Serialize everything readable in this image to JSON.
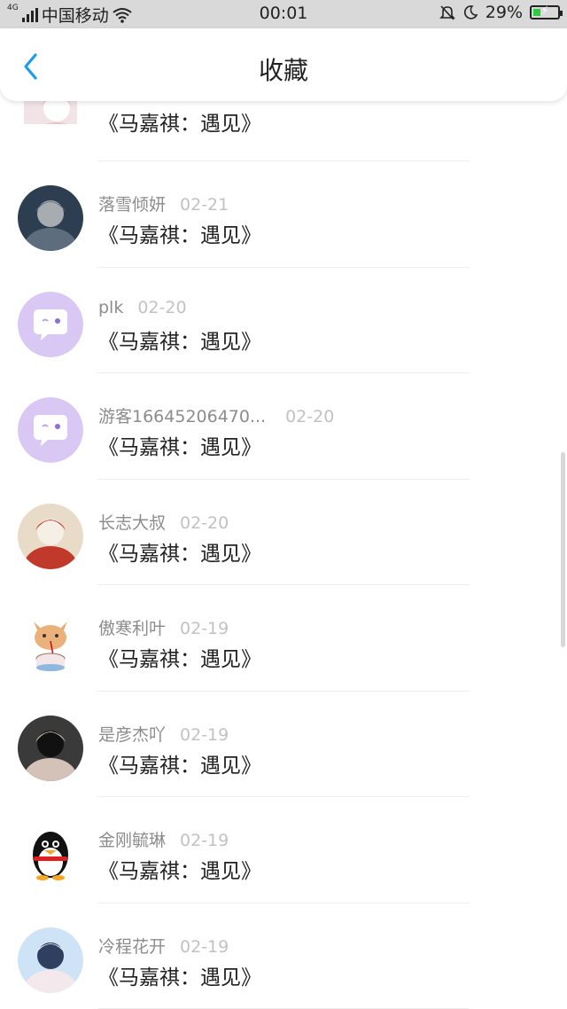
{
  "status_bar": {
    "network": "4G",
    "carrier": "中国移动",
    "time": "00:01",
    "battery": "29%",
    "battery_level": 0.29
  },
  "header": {
    "title": "收藏",
    "back_icon": "chevron-left-icon",
    "accent": "#1e9be9"
  },
  "items": [
    {
      "name": "",
      "date": "",
      "text": "《马嘉祺：遇见》",
      "avatar": "photo"
    },
    {
      "name": "落雪倾妍",
      "date": "02-21",
      "text": "《马嘉祺：遇见》",
      "avatar": "photo"
    },
    {
      "name": "plk",
      "date": "02-20",
      "text": "《马嘉祺：遇见》",
      "avatar": "default-chat"
    },
    {
      "name": "游客16645206470...",
      "date": "02-20",
      "text": "《马嘉祺：遇见》",
      "avatar": "default-chat"
    },
    {
      "name": "长志大叔",
      "date": "02-20",
      "text": "《马嘉祺：遇见》",
      "avatar": "photo"
    },
    {
      "name": "傲寒利叶",
      "date": "02-19",
      "text": "《马嘉祺：遇见》",
      "avatar": "cat"
    },
    {
      "name": "是彦杰吖",
      "date": "02-19",
      "text": "《马嘉祺：遇见》",
      "avatar": "photo"
    },
    {
      "name": "金刚毓琳",
      "date": "02-19",
      "text": "《马嘉祺：遇见》",
      "avatar": "penguin"
    },
    {
      "name": "冷程花开",
      "date": "02-19",
      "text": "《马嘉祺：遇见》",
      "avatar": "photo"
    }
  ]
}
